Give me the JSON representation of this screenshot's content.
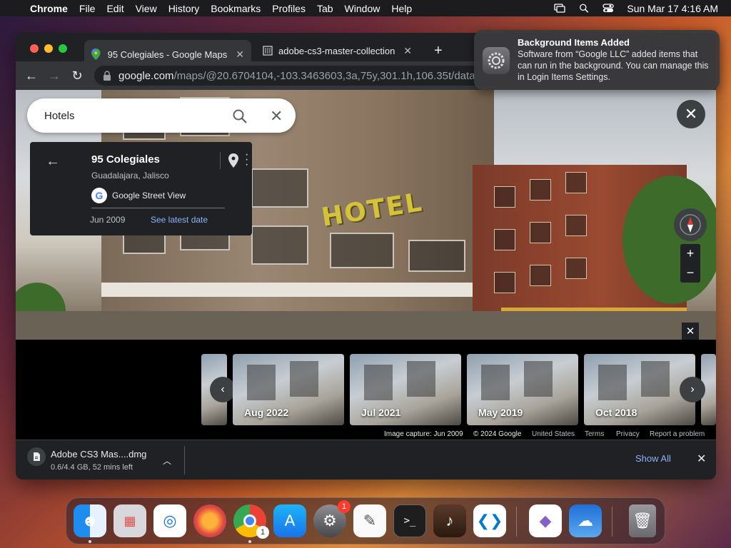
{
  "menubar": {
    "app": "Chrome",
    "items": [
      "File",
      "Edit",
      "View",
      "History",
      "Bookmarks",
      "Profiles",
      "Tab",
      "Window",
      "Help"
    ],
    "clock": "Sun Mar 17  4:16 AM"
  },
  "browser": {
    "tabs": [
      {
        "title": "95 Colegiales - Google Maps",
        "icon": "google-maps-pin-icon"
      },
      {
        "title": "adobe-cs3-master-collection",
        "icon": "archive-icon"
      }
    ],
    "url_host": "google.com",
    "url_path": "/maps/@20.6704104,-103.3463603,3a,75y,301.1h,106.35t/data"
  },
  "maps": {
    "search": {
      "value": "Hotels"
    },
    "place": {
      "title": "95 Colegiales",
      "subtitle": "Guadalajara, Jalisco",
      "source": "Google Street View",
      "date": "Jun 2009",
      "latest_link": "See latest date"
    },
    "sign_text": "HOTEL",
    "timeline": [
      "Aug 2022",
      "Jul 2021",
      "May 2019",
      "Oct 2018"
    ],
    "attribution": {
      "capture": "Image capture: Jun 2009",
      "copyright": "© 2024 Google",
      "region": "United States",
      "terms": "Terms",
      "privacy": "Privacy",
      "report": "Report a problem"
    },
    "zoom_in": "+",
    "zoom_out": "−"
  },
  "download": {
    "filename": "Adobe CS3 Mas....dmg",
    "status": "0.6/4.4 GB, 52 mins left",
    "show_all": "Show All"
  },
  "notification": {
    "title": "Background Items Added",
    "body": "Software from “Google LLC” added items that can run in the background. You can manage this in Login Items Settings."
  },
  "dock": {
    "apps": [
      "Finder",
      "Launchpad",
      "Safari",
      "Firefox",
      "Chrome",
      "App Store",
      "System Settings",
      "TextEdit",
      "Terminal",
      "GarageBand",
      "Visual Studio Code",
      "Visual Studio",
      "Weather",
      "Trash"
    ],
    "chrome_badge": "1",
    "settings_badge": "1"
  },
  "colors": {
    "accent_link": "#8ab4f8",
    "badge": "#ff3b30"
  }
}
